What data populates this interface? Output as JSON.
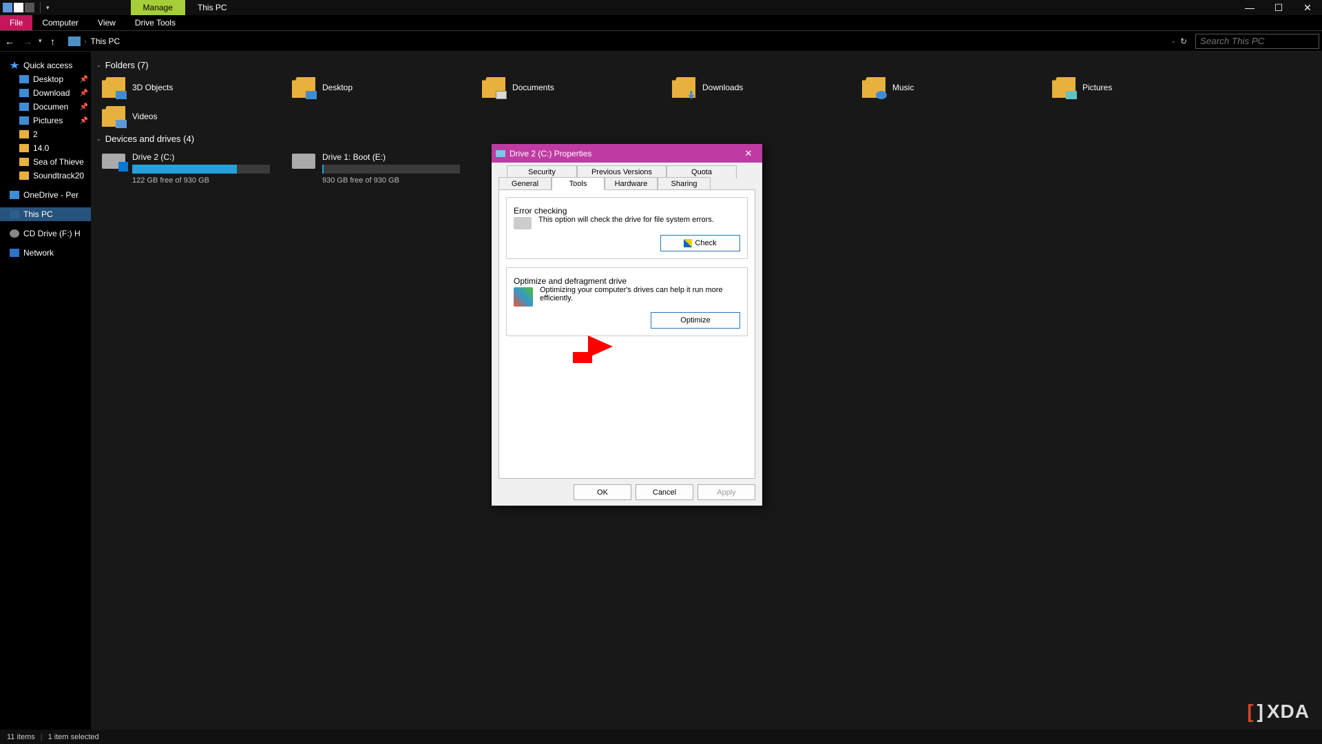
{
  "titlebar": {
    "tab_manage": "Manage",
    "tab_context": "This PC"
  },
  "ribbon": {
    "file": "File",
    "computer": "Computer",
    "view": "View",
    "drive_tools": "Drive Tools"
  },
  "addressbar": {
    "location": "This PC",
    "search_placeholder": "Search This PC"
  },
  "sidebar": {
    "quick_access": "Quick access",
    "items_qa": [
      "Desktop",
      "Download",
      "Documen",
      "Pictures",
      "2",
      "14.0",
      "Sea of Thieve",
      "Soundtrack20"
    ],
    "onedrive": "OneDrive - Per",
    "this_pc": "This PC",
    "cd_drive": "CD Drive (F:) H",
    "network": "Network"
  },
  "content": {
    "folders_header": "Folders (7)",
    "folders": [
      "3D Objects",
      "Desktop",
      "Documents",
      "Downloads",
      "Music",
      "Pictures",
      "Videos"
    ],
    "drives_header": "Devices and drives (4)",
    "drives": [
      {
        "name": "Drive 2 (C:)",
        "free": "122 GB free of 930 GB",
        "fill": 76
      },
      {
        "name": "Drive 1: Boot (E:)",
        "free": "930 GB free of 930 GB",
        "fill": 1
      }
    ]
  },
  "dialog": {
    "title": "Drive 2 (C:) Properties",
    "tabs": {
      "security": "Security",
      "prev": "Previous Versions",
      "quota": "Quota",
      "general": "General",
      "tools": "Tools",
      "hardware": "Hardware",
      "sharing": "Sharing"
    },
    "error_checking": {
      "legend": "Error checking",
      "text": "This option will check the drive for file system errors.",
      "button": "Check"
    },
    "optimize": {
      "legend": "Optimize and defragment drive",
      "text": "Optimizing your computer's drives can help it run more efficiently.",
      "button": "Optimize"
    },
    "buttons": {
      "ok": "OK",
      "cancel": "Cancel",
      "apply": "Apply"
    }
  },
  "statusbar": {
    "count": "11 items",
    "selected": "1 item selected"
  },
  "watermark": "XDA"
}
